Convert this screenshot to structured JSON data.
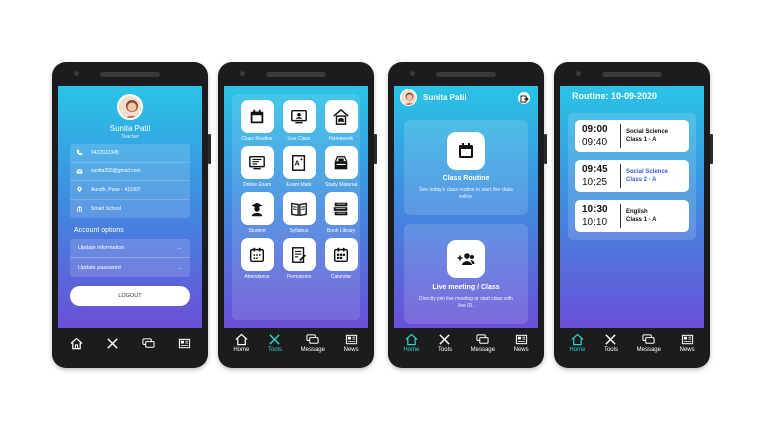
{
  "nav": {
    "home": "Home",
    "tools": "Tools",
    "message": "Message",
    "news": "News"
  },
  "profile": {
    "name": "Sunita Patil",
    "role": "Teacher",
    "phone": "9422012345",
    "email": "sunita203@gmail.com",
    "address": "Aundh, Pune - 411007",
    "school": "Smart School",
    "section_title": "Account options",
    "options": [
      "Update information",
      "Update password"
    ],
    "logout": "LOGOUT"
  },
  "tools": {
    "items": [
      {
        "label": "Class Routine",
        "icon": "calendar-icon"
      },
      {
        "label": "Live Class",
        "icon": "live-class-icon"
      },
      {
        "label": "Homework",
        "icon": "homework-icon"
      },
      {
        "label": "Online Exam",
        "icon": "online-exam-icon"
      },
      {
        "label": "Exam Mark",
        "icon": "exam-mark-icon"
      },
      {
        "label": "Study Material",
        "icon": "study-material-icon"
      },
      {
        "label": "Student",
        "icon": "student-icon"
      },
      {
        "label": "Syllabus",
        "icon": "syllabus-icon"
      },
      {
        "label": "Book Library",
        "icon": "book-library-icon"
      },
      {
        "label": "Attendance",
        "icon": "attendance-icon"
      },
      {
        "label": "Permission",
        "icon": "permission-icon"
      },
      {
        "label": "Calendar",
        "icon": "calendar-grid-icon"
      }
    ]
  },
  "home": {
    "user_name": "Sunita Patil",
    "class_routine_title": "Class Routine",
    "class_routine_desc": "See today's class routine to start live class online.",
    "live_meeting_title": "Live meeting / Class",
    "live_meeting_desc": "Directly join live meeting or start class with live ID."
  },
  "routine": {
    "title": "Routine: 10-09-2020",
    "entries": [
      {
        "start": "09:00",
        "end": "09:40",
        "subject": "Social Science",
        "class": "Class 1 - A"
      },
      {
        "start": "09:45",
        "end": "10:25",
        "subject": "Social Science",
        "class": "Class 2 - A"
      },
      {
        "start": "10:30",
        "end": "10:10",
        "subject": "English",
        "class": "Class 1 - A"
      }
    ]
  },
  "colors": {
    "gradient_top": "#29c4e6",
    "gradient_bottom": "#6a4fd6",
    "active_nav": "#2fd3c7",
    "highlight_text": "#3a5bd8"
  }
}
